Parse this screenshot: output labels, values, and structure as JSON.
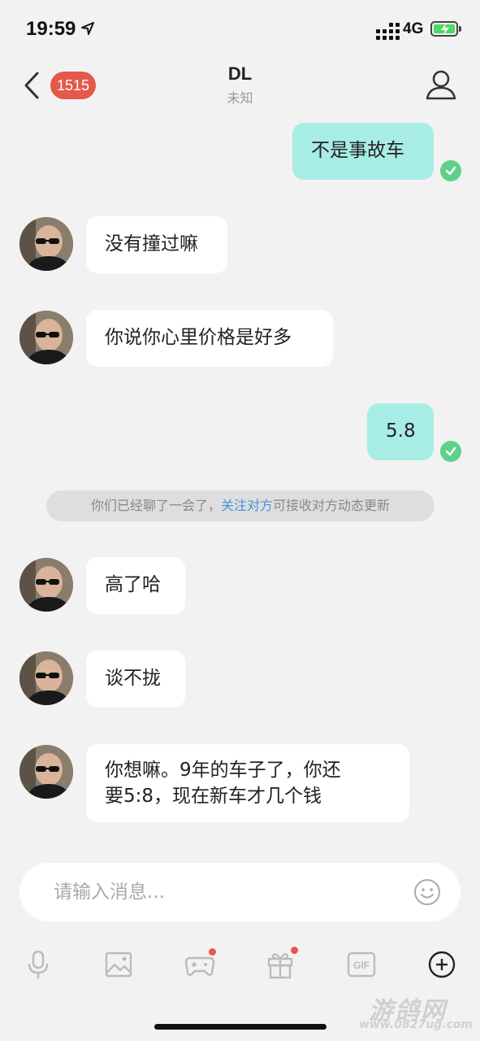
{
  "status_bar": {
    "time": "19:59",
    "network": "4G"
  },
  "header": {
    "unread_count": "1515",
    "title": "DL",
    "subtitle": "未知"
  },
  "messages": [
    {
      "side": "out",
      "text": "不是事故车"
    },
    {
      "side": "in",
      "text": "没有撞过嘛"
    },
    {
      "side": "in",
      "text": "你说你心里价格是好多"
    },
    {
      "side": "out",
      "text": "5.8"
    },
    {
      "side": "in",
      "text": "高了哈"
    },
    {
      "side": "in",
      "text": "谈不拢"
    },
    {
      "side": "in",
      "text": "你想嘛。9年的车子了，你还\n要5:8，现在新车才几个钱"
    }
  ],
  "system_notice": {
    "before": "你们已经聊了一会了，",
    "link": "关注对方",
    "after": "可接收对方动态更新"
  },
  "input": {
    "placeholder": "请输入消息..."
  },
  "toolbar": [
    "mic-icon",
    "image-icon",
    "game-icon",
    "gift-icon",
    "gif-icon",
    "plus-icon"
  ],
  "watermark": {
    "main": "游鸽网",
    "url": "www.0827ug.com"
  },
  "colors": {
    "outgoing_bubble": "#a8ece6",
    "incoming_bubble": "#ffffff",
    "badge": "#e5584a",
    "link": "#4a90e2",
    "read_check": "#5fd08a"
  }
}
